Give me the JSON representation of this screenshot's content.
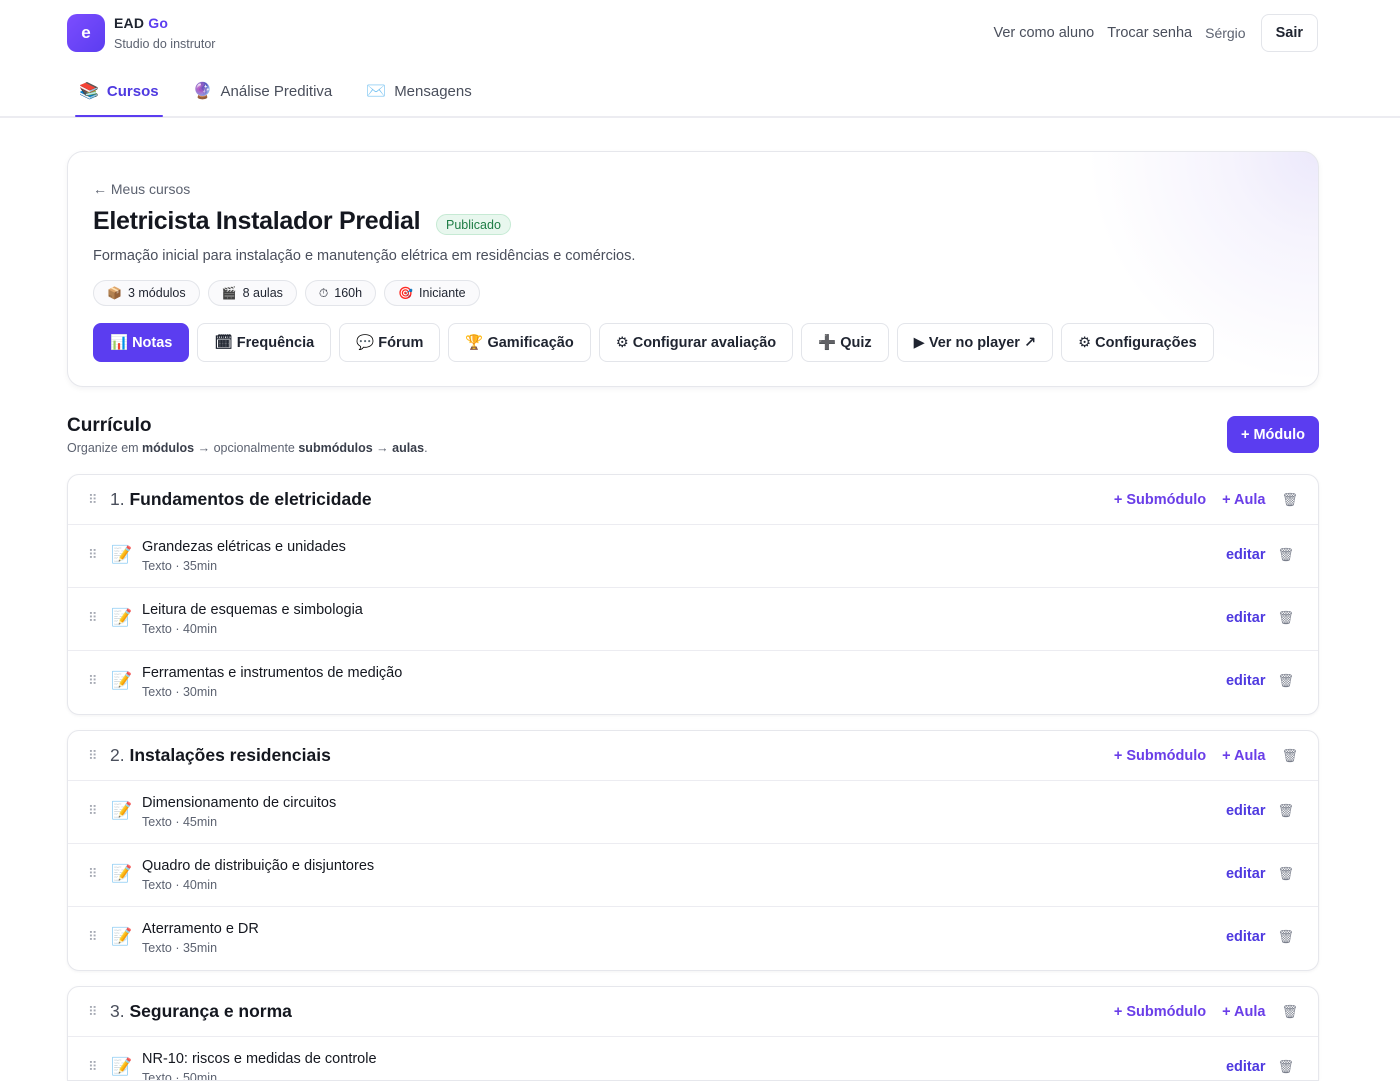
{
  "brand": {
    "logo_letter": "e",
    "name_primary": "EAD",
    "name_accent": "Go",
    "subtitle": "Studio do instrutor"
  },
  "top_links": {
    "view_as_student": "Ver como aluno",
    "change_password": "Trocar senha",
    "user": "Sérgio",
    "logout": "Sair"
  },
  "nav_tabs": [
    {
      "icon": "📚",
      "label": "Cursos",
      "active": true
    },
    {
      "icon": "🔮",
      "label": "Análise Preditiva",
      "active": false
    },
    {
      "icon": "✉️",
      "label": "Mensagens",
      "active": false
    }
  ],
  "course": {
    "back": "← Meus cursos",
    "title": "Eletricista Instalador Predial",
    "status": "Publicado",
    "description": "Formação inicial para instalação e manutenção elétrica em residências e comércios.",
    "chips": [
      {
        "icon": "📦",
        "label": "3 módulos"
      },
      {
        "icon": "🎬",
        "label": "8 aulas"
      },
      {
        "icon": "⏱",
        "label": "160h"
      },
      {
        "icon": "🎯",
        "label": "Iniciante"
      }
    ],
    "actions": [
      {
        "label": "📊 Notas"
      },
      {
        "label": "🗓 Frequência"
      },
      {
        "label": "💬 Fórum"
      },
      {
        "label": "🏆 Gamificação"
      },
      {
        "label": "⚙ Configurar avaliação"
      },
      {
        "label": "➕ Quiz"
      },
      {
        "label": "▶ Ver no player ↗"
      },
      {
        "label": "⚙ Configurações"
      }
    ]
  },
  "curriculum": {
    "title": "Currículo",
    "subtitle_pre": "Organize em ",
    "subtitle_b1": "módulos",
    "subtitle_mid": " → opcionalmente ",
    "subtitle_b2": "submódulos",
    "subtitle_arrow": " → ",
    "subtitle_b3": "aulas",
    "subtitle_end": ".",
    "add_module": "+ Módulo",
    "add_submodule": "+ Submódulo",
    "add_lesson": "+ Aula",
    "edit": "editar",
    "modules": [
      {
        "num": "1.",
        "title": "Fundamentos de eletricidade",
        "lessons": [
          {
            "title": "Grandezas elétricas e unidades",
            "meta": "Texto · 35min"
          },
          {
            "title": "Leitura de esquemas e simbologia",
            "meta": "Texto · 40min"
          },
          {
            "title": "Ferramentas e instrumentos de medição",
            "meta": "Texto · 30min"
          }
        ]
      },
      {
        "num": "2.",
        "title": "Instalações residenciais",
        "lessons": [
          {
            "title": "Dimensionamento de circuitos",
            "meta": "Texto · 45min"
          },
          {
            "title": "Quadro de distribuição e disjuntores",
            "meta": "Texto · 40min"
          },
          {
            "title": "Aterramento e DR",
            "meta": "Texto · 35min"
          }
        ]
      },
      {
        "num": "3.",
        "title": "Segurança e norma",
        "lessons": [
          {
            "title": "NR-10: riscos e medidas de controle",
            "meta": "Texto · 50min"
          }
        ]
      }
    ]
  },
  "colors": {
    "accent": "#5b3df0",
    "status_green": "#1e7d45"
  }
}
